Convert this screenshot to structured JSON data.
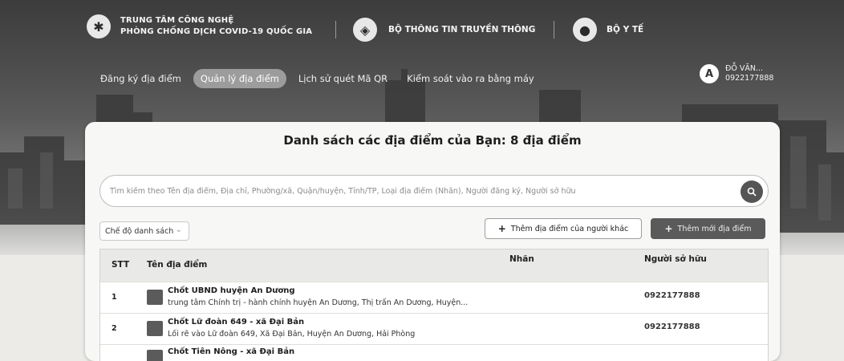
{
  "header": {
    "org_primary": {
      "line1": "TRUNG TÂM CÔNG NGHỆ",
      "line2": "PHÒNG CHỐNG DỊCH COVID-19 QUỐC GIA"
    },
    "org_secondary": "BỘ THÔNG TIN TRUYỀN THÔNG",
    "org_tertiary": "BỘ Y TẾ",
    "nav": [
      {
        "label": "Đăng ký địa điểm",
        "active": false
      },
      {
        "label": "Quản lý địa điểm",
        "active": true
      },
      {
        "label": "Lịch sử quét Mã QR",
        "active": false
      },
      {
        "label": "Kiểm soát vào ra bằng máy",
        "active": false
      }
    ],
    "user": {
      "name": "ĐỖ VĂN...",
      "phone": "0922177888"
    }
  },
  "main": {
    "title": "Danh sách các địa điểm của Bạn: 8 địa điểm",
    "search_placeholder": "Tìm kiếm theo Tên địa điểm, Địa chỉ, Phường/xã, Quận/huyện, Tỉnh/TP, Loại địa điểm (Nhãn), Người đăng ký, Người sở hữu",
    "mode_select": "Chế độ danh sách",
    "add_other_label": "Thêm địa điểm của người khác",
    "add_new_label": "Thêm mới địa điểm",
    "table": {
      "columns": [
        "STT",
        "Tên địa điểm",
        "Nhãn",
        "Người sở hữu"
      ],
      "rows": [
        {
          "stt": "1",
          "name": "Chốt UBND huyện An Dương",
          "address": "trung tâm Chính trị - hành chính huyện An Dương, Thị trấn An Dương, Huyện...",
          "owner": "0922177888"
        },
        {
          "stt": "2",
          "name": "Chốt Lữ đoàn 649 - xã Đại Bản",
          "address": "Lối rẽ vào Lữ đoàn 649, Xã Đại Bản, Huyện An Dương, Hải Phòng",
          "owner": "0922177888"
        },
        {
          "stt": "",
          "name": "Chốt Tiên Nông - xã Đại Bản",
          "address": "",
          "owner": ""
        }
      ]
    }
  },
  "colors": {
    "active_nav": "#9c9c9c",
    "primary_button": "#5a5a5a",
    "card_bg": "#f7f7f6"
  }
}
